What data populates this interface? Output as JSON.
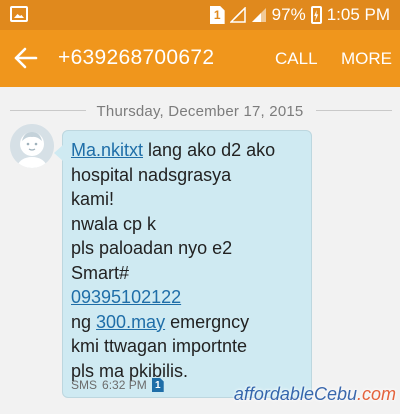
{
  "status_bar": {
    "sim_slot": "1",
    "battery_percent": "97%",
    "time": "1:05 PM"
  },
  "app_bar": {
    "contact_number": "+639268700672",
    "call_label": "CALL",
    "more_label": "MORE"
  },
  "conversation": {
    "date_separator": "Thursday, December 17, 2015",
    "message": {
      "lines": [
        {
          "link": "Ma.nkitxt",
          "text": " lang ako d2 ako"
        },
        {
          "text": "hospital nadsgrasya"
        },
        {
          "text": "kami!"
        },
        {
          "text": "nwala cp k"
        },
        {
          "text": "pls paloadan nyo e2"
        },
        {
          "text": "Smart#"
        },
        {
          "link": "09395102122"
        },
        {
          "prefix": "ng ",
          "link": "300.may",
          "text": " emergncy"
        },
        {
          "text": "kmi ttwagan importnte"
        },
        {
          "text": "pls ma pkibilis."
        }
      ],
      "type_label": "SMS",
      "time": "6:32 PM",
      "sim_slot": "1"
    }
  },
  "watermark": {
    "brand": "affordableCebu",
    "tld": ".com"
  },
  "colors": {
    "status_bar": "#e0891d",
    "app_bar": "#f0961c",
    "bubble": "#cfeaf2",
    "link": "#1f6ea8"
  },
  "icons": {
    "back": "arrow-left-icon",
    "notification": "gallery-icon",
    "avatar": "contact-avatar-icon"
  }
}
